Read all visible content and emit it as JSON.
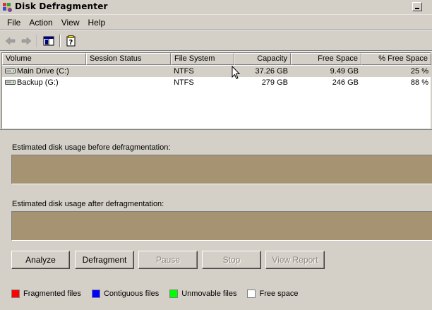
{
  "window": {
    "title": "Disk Defragmenter"
  },
  "menu": {
    "items": [
      "File",
      "Action",
      "View",
      "Help"
    ]
  },
  "toolbar": {
    "icons": [
      "back-arrow-icon",
      "forward-arrow-icon",
      "show-hide-console-tree-icon",
      "help-icon"
    ]
  },
  "volumes": {
    "columns": [
      "Volume",
      "Session Status",
      "File System",
      "Capacity",
      "Free Space",
      "% Free Space"
    ],
    "rows": [
      {
        "volume": "Main Drive (C:)",
        "status": "",
        "fs": "NTFS",
        "capacity": "37.26 GB",
        "free": "9.49 GB",
        "pct": "25 %"
      },
      {
        "volume": "Backup (G:)",
        "status": "",
        "fs": "NTFS",
        "capacity": "279 GB",
        "free": "246 GB",
        "pct": "88 %"
      }
    ]
  },
  "analysis": {
    "before_label": "Estimated disk usage before defragmentation:",
    "after_label": "Estimated disk usage after defragmentation:"
  },
  "buttons": {
    "analyze": "Analyze",
    "defragment": "Defragment",
    "pause": "Pause",
    "stop": "Stop",
    "view_report": "View Report"
  },
  "legend": {
    "fragmented": "Fragmented files",
    "contiguous": "Contiguous files",
    "unmovable": "Unmovable files",
    "free": "Free space"
  },
  "colors": {
    "fragmented": "#ff0000",
    "contiguous": "#0000ff",
    "unmovable": "#00ff00",
    "free": "#ffffff",
    "usage_bar": "#a59371"
  }
}
